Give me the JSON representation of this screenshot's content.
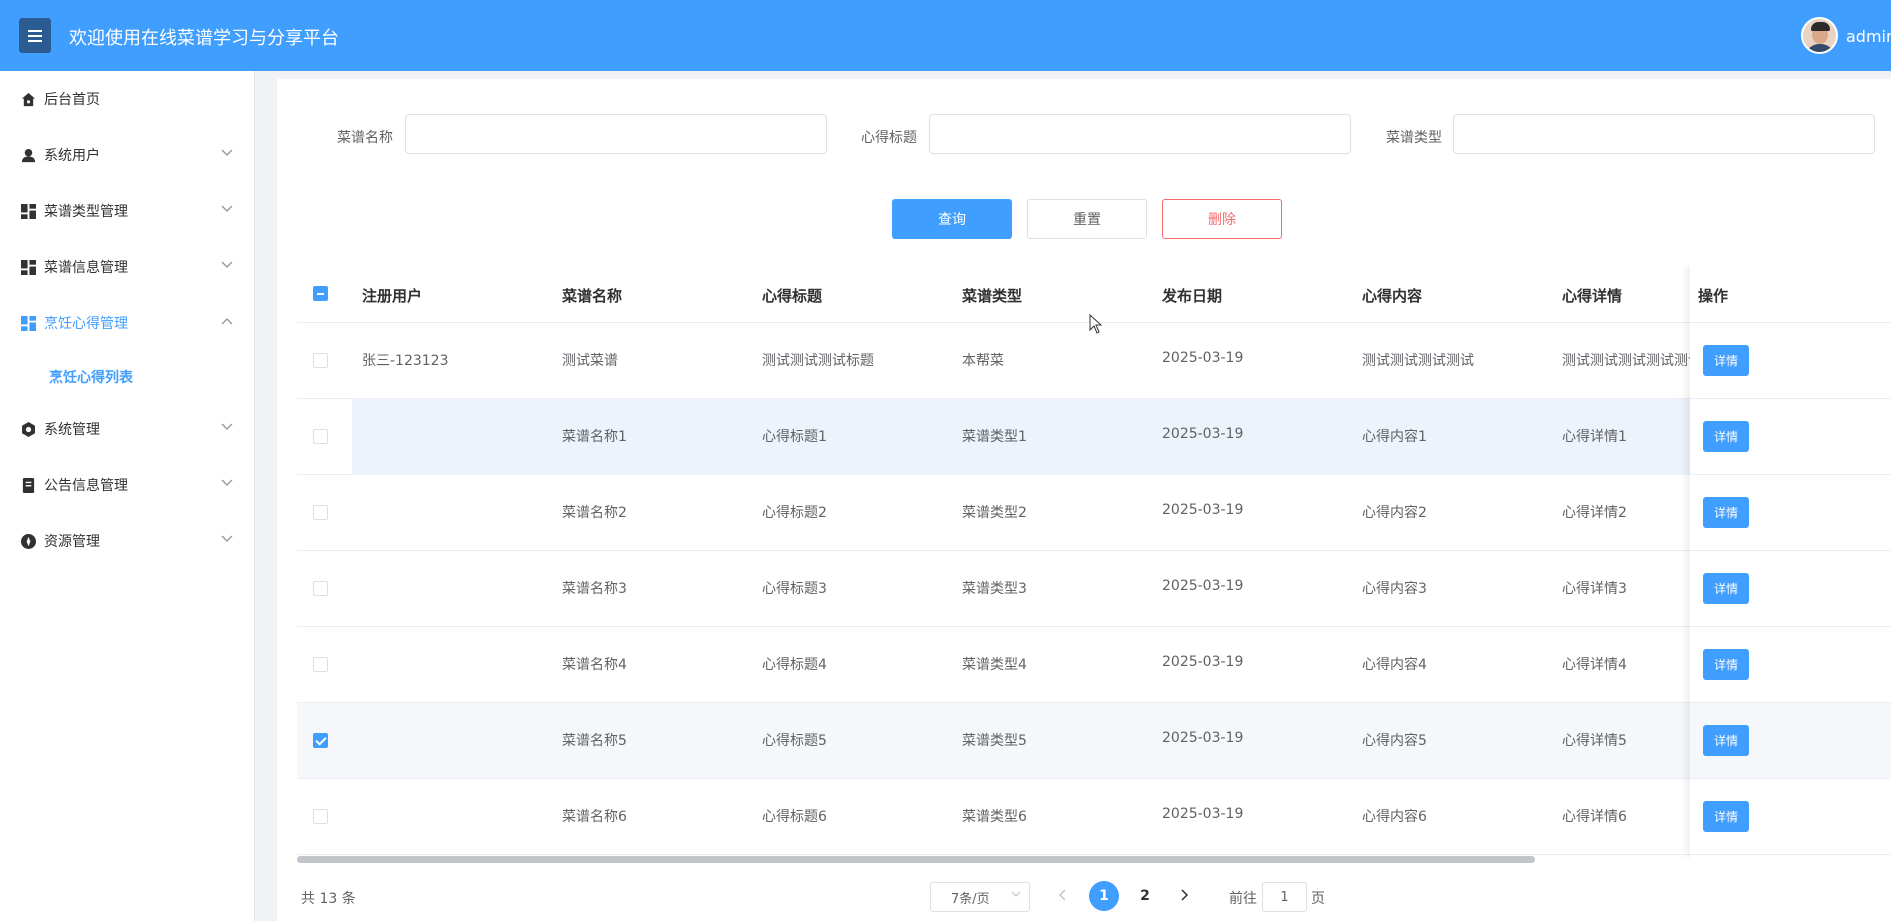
{
  "header": {
    "menu_icon": "hamburger-icon",
    "title": "欢迎使用在线菜谱学习与分享平台",
    "user_name": "admin"
  },
  "sidebar": {
    "items": [
      {
        "label": "后台首页",
        "icon": "home-icon",
        "expandable": false
      },
      {
        "label": "系统用户",
        "icon": "user-icon",
        "expandable": true
      },
      {
        "label": "菜谱类型管理",
        "icon": "grid-icon",
        "expandable": true
      },
      {
        "label": "菜谱信息管理",
        "icon": "grid-icon",
        "expandable": true
      },
      {
        "label": "烹饪心得管理",
        "icon": "grid-icon",
        "expandable": true,
        "expanded": true,
        "active": true
      },
      {
        "label": "系统管理",
        "icon": "gear-icon",
        "expandable": true
      },
      {
        "label": "公告信息管理",
        "icon": "document-icon",
        "expandable": true
      },
      {
        "label": "资源管理",
        "icon": "compass-icon",
        "expandable": true
      }
    ],
    "sub_item": "烹饪心得列表"
  },
  "search": {
    "recipe_name_label": "菜谱名称",
    "experience_title_label": "心得标题",
    "recipe_type_label": "菜谱类型",
    "recipe_name_value": "",
    "experience_title_value": "",
    "recipe_type_value": ""
  },
  "actions": {
    "query": "查询",
    "reset": "重置",
    "delete": "删除"
  },
  "table": {
    "columns": [
      "注册用户",
      "菜谱名称",
      "心得标题",
      "菜谱类型",
      "发布日期",
      "心得内容",
      "心得详情",
      "操作"
    ],
    "rows": [
      {
        "user": "张三-123123",
        "recipe_name": "测试菜谱",
        "title": "测试测试测试标题",
        "type": "本帮菜",
        "date": "2025-03-19",
        "content": "测试测试测试测试",
        "detail": "测试测试测试测试测试",
        "checked": false
      },
      {
        "user": "",
        "recipe_name": "菜谱名称1",
        "title": "心得标题1",
        "type": "菜谱类型1",
        "date": "2025-03-19",
        "content": "心得内容1",
        "detail": "心得详情1",
        "checked": false
      },
      {
        "user": "",
        "recipe_name": "菜谱名称2",
        "title": "心得标题2",
        "type": "菜谱类型2",
        "date": "2025-03-19",
        "content": "心得内容2",
        "detail": "心得详情2",
        "checked": false
      },
      {
        "user": "",
        "recipe_name": "菜谱名称3",
        "title": "心得标题3",
        "type": "菜谱类型3",
        "date": "2025-03-19",
        "content": "心得内容3",
        "detail": "心得详情3",
        "checked": false
      },
      {
        "user": "",
        "recipe_name": "菜谱名称4",
        "title": "心得标题4",
        "type": "菜谱类型4",
        "date": "2025-03-19",
        "content": "心得内容4",
        "detail": "心得详情4",
        "checked": false
      },
      {
        "user": "",
        "recipe_name": "菜谱名称5",
        "title": "心得标题5",
        "type": "菜谱类型5",
        "date": "2025-03-19",
        "content": "心得内容5",
        "detail": "心得详情5",
        "checked": true
      },
      {
        "user": "",
        "recipe_name": "菜谱名称6",
        "title": "心得标题6",
        "type": "菜谱类型6",
        "date": "2025-03-19",
        "content": "心得内容6",
        "detail": "心得详情6",
        "checked": false
      }
    ],
    "detail_button": "详情"
  },
  "pagination": {
    "total": "共 13 条",
    "page_size": "7条/页",
    "pages": [
      "1",
      "2"
    ],
    "current_page": "1",
    "goto_prefix": "前往",
    "goto_value": "1",
    "goto_suffix": "页"
  },
  "colors": {
    "primary": "#409eff",
    "danger": "#f56c6c",
    "menu_toggle": "#2c5b91"
  }
}
